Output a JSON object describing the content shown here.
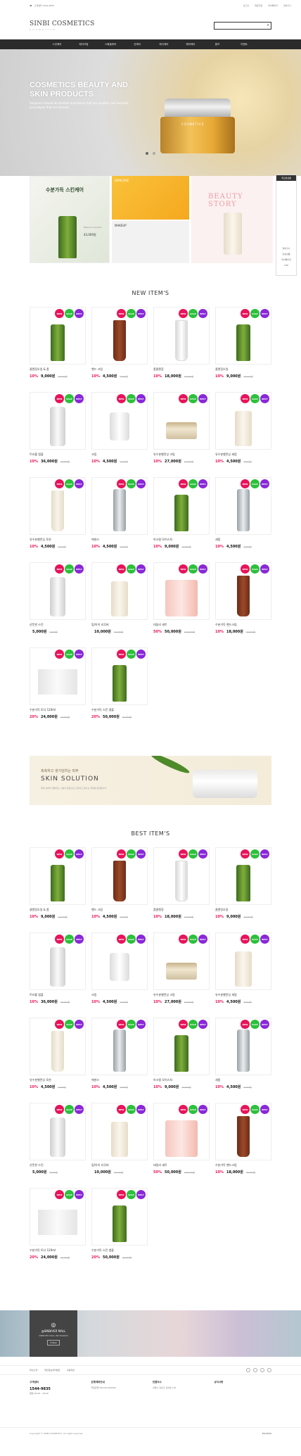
{
  "topbar": {
    "phone": "고객센터 1544-9835",
    "links": [
      "로그인",
      "회원가입",
      "마이페이지",
      "장바구니"
    ]
  },
  "header": {
    "logo": "SINBI COSMETICS",
    "logo_sub": "COSMETICS"
  },
  "nav": [
    "스킨케어",
    "메이크업",
    "스페셜케어",
    "선케어",
    "바디케어",
    "헤어케어",
    "옴므",
    "이벤트"
  ],
  "hero": {
    "title": "COSMETICS BEAUTY AND SKIN PRODUCTS",
    "desc": "Surgeons should do medical operations that are needed, not cosmetic procedures that are desired.",
    "jar_label": "COSMETICS"
  },
  "promo": {
    "p1_title": "수분가득 스킨케어",
    "p1_small": "Natural Cosmetic",
    "p1_price": "43,000원",
    "p2_tag": "SKINCARE",
    "p3_tag": "MAKEUP",
    "p4_title": "BEAUTY STORY"
  },
  "sidebar": {
    "title": "최근본상품",
    "links": [
      "장바구니",
      "관심상품",
      "마이페이지",
      "TOP"
    ]
  },
  "sections": {
    "new": "NEW ITEM'S",
    "best": "BEST ITEM'S"
  },
  "badges": {
    "new": "NEW",
    "sale": "SALE",
    "best": "BEST"
  },
  "products": [
    {
      "name": "클렌징오일 & 폼",
      "pct": "10%",
      "price": "9,000원",
      "old": "10,000원",
      "type": "bottle-green"
    },
    {
      "name": "핸드 크림",
      "pct": "10%",
      "price": "4,500원",
      "old": "5,000원",
      "type": "tube-dark"
    },
    {
      "name": "폼클렌징",
      "pct": "10%",
      "price": "18,000원",
      "old": "20,000원",
      "type": "tube-white"
    },
    {
      "name": "클렌징오일",
      "pct": "10%",
      "price": "9,000원",
      "old": "10,000원",
      "type": "bottle-green"
    },
    {
      "name": "트러블 앰플",
      "pct": "10%",
      "price": "36,000원",
      "old": "40,000원",
      "type": "pump-white"
    },
    {
      "name": "크림",
      "pct": "10%",
      "price": "4,500원",
      "old": "5,000원",
      "type": "cap-white"
    },
    {
      "name": "유수분밸런싱 크림",
      "pct": "10%",
      "price": "27,000원",
      "old": "30,000원",
      "type": "jar-small"
    },
    {
      "name": "유수분밸런싱 세럼",
      "pct": "10%",
      "price": "4,500원",
      "old": "5,000원",
      "type": "glass"
    },
    {
      "name": "유수분밸런싱 로션",
      "pct": "10%",
      "price": "4,500원",
      "old": "5,000원",
      "type": "tube-cream"
    },
    {
      "name": "에센스",
      "pct": "10%",
      "price": "4,500원",
      "old": "5,000원",
      "type": "pump-silver"
    },
    {
      "name": "아크릴 모이스처",
      "pct": "10%",
      "price": "9,000원",
      "old": "10,000원",
      "type": "bottle-green"
    },
    {
      "name": "세럼",
      "pct": "10%",
      "price": "4,500원",
      "old": "5,000원",
      "type": "pump-silver"
    },
    {
      "name": "산뜻한 스킨",
      "pct": "",
      "price": "5,000원",
      "old": "5,000원",
      "type": "pump-white"
    },
    {
      "name": "립/아이 리무버",
      "pct": "",
      "price": "10,000원",
      "old": "10,000원",
      "type": "glass"
    },
    {
      "name": "데일리 세트",
      "pct": "50%",
      "price": "50,000원",
      "old": "100,000원",
      "type": "pink-set"
    },
    {
      "name": "수분가득 핸드크림",
      "pct": "10%",
      "price": "18,000원",
      "old": "20,000원",
      "type": "tube-dark"
    },
    {
      "name": "수분가득 토너 120ml",
      "pct": "20%",
      "price": "24,000원",
      "old": "30,000원",
      "type": "box"
    },
    {
      "name": "수분가득 스킨 앰플",
      "pct": "20%",
      "price": "50,000원",
      "old": "60,000원",
      "type": "bottle-green"
    }
  ],
  "banner": {
    "k": "촉촉하고 생기넘치는 피부",
    "en": "SKIN SOLUTION",
    "desc": "피부 속부터 채워주는 수분과 영양으로 건강하고 빛나는 피부를 완성합니다."
  },
  "instagram": {
    "title": "@SINBIVER MALL",
    "sub": "SINBIVER MALL INSTAGRAM",
    "btn": "Follow"
  },
  "footer": {
    "links": [
      "회사소개",
      "개인정보처리방침",
      "이용약관"
    ],
    "cs_title": "고객센터",
    "cs_phone": "1544-9835",
    "cs_hours": "평일 09:00 - 18:00",
    "bank_title": "은행계좌안내",
    "bank_info": "국민은행 000-00-000000",
    "return_title": "반품주소",
    "return_info": "서울시 강남구 신비로 123",
    "notice_title": "공지사항",
    "copyright": "Copyright © SINBI COSMETICS. All rights reserved.",
    "escrow": "ESCROW"
  }
}
